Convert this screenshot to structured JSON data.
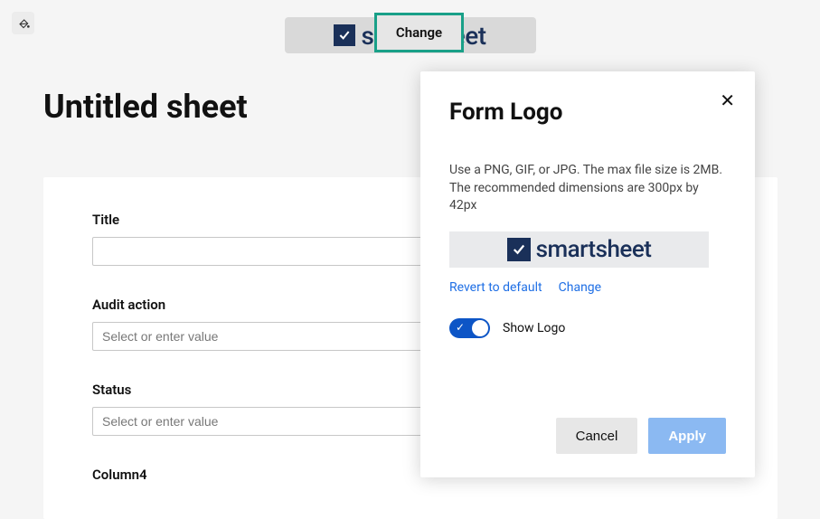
{
  "header": {
    "change_overlay_label": "Change"
  },
  "page": {
    "title": "Untitled sheet"
  },
  "form": {
    "fields": [
      {
        "label": "Title",
        "placeholder": ""
      },
      {
        "label": "Audit action",
        "placeholder": "Select or enter value"
      },
      {
        "label": "Status",
        "placeholder": "Select or enter value"
      },
      {
        "label": "Column4",
        "placeholder": ""
      }
    ]
  },
  "panel": {
    "title": "Form Logo",
    "description": "Use a PNG, GIF, or JPG. The max file size is 2MB. The recommended dimensions are 300px by 42px",
    "revert_label": "Revert to default",
    "change_label": "Change",
    "toggle_label": "Show Logo",
    "toggle_on": true,
    "cancel_label": "Cancel",
    "apply_label": "Apply"
  },
  "brand": {
    "name": "smartsheet"
  },
  "colors": {
    "brand_navy": "#1a3059",
    "accent_teal": "#19a088",
    "link_blue": "#1f6fe5",
    "toggle_blue": "#0d55c6",
    "apply_blue": "#8bb9f2"
  }
}
